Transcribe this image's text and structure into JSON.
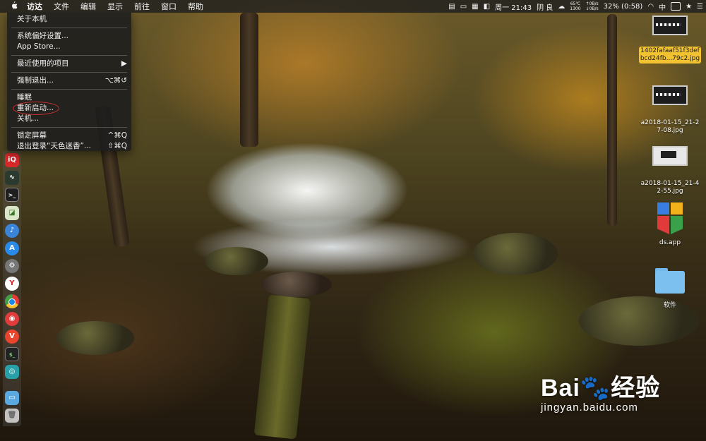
{
  "menubar": {
    "apple_icon": "apple-logo",
    "items": [
      "访达",
      "文件",
      "编辑",
      "显示",
      "前往",
      "窗口",
      "帮助"
    ],
    "clock": "周一 21:43",
    "weather": "阴 良",
    "temp_top": "65℃",
    "temp_bottom": "1300",
    "net_up": "↑0B/s",
    "net_down": "↓0B/s",
    "battery": "32% (0:58)",
    "input_method": "中"
  },
  "apple_menu": {
    "about": "关于本机",
    "prefs": "系统偏好设置...",
    "appstore": "App Store...",
    "recent": "最近使用的项目",
    "recent_arrow": "▶",
    "force_quit": "强制退出...",
    "force_quit_sc": "⌥⌘↺",
    "sleep": "睡眠",
    "restart": "重新启动...",
    "shutdown": "关机...",
    "lock": "锁定屏幕",
    "lock_sc": "^⌘Q",
    "logout": "退出登录“天色迷香”...",
    "logout_sc": "⇧⌘Q"
  },
  "desktop": {
    "file1_line1": "1402fafaaf51f3def",
    "file1_line2": "bcd24fb...79c2.jpg",
    "file2_line1": "a2018-01-15_21-2",
    "file2_line2": "7-08.jpg",
    "file3_line1": "a2018-01-15_21-4",
    "file3_line2": "2-55.jpg",
    "file4": "ds.app",
    "file5": "软件"
  },
  "watermark": {
    "logo_text": "Bai",
    "logo_suffix": "经验",
    "url": "jingyan.baidu.com"
  }
}
